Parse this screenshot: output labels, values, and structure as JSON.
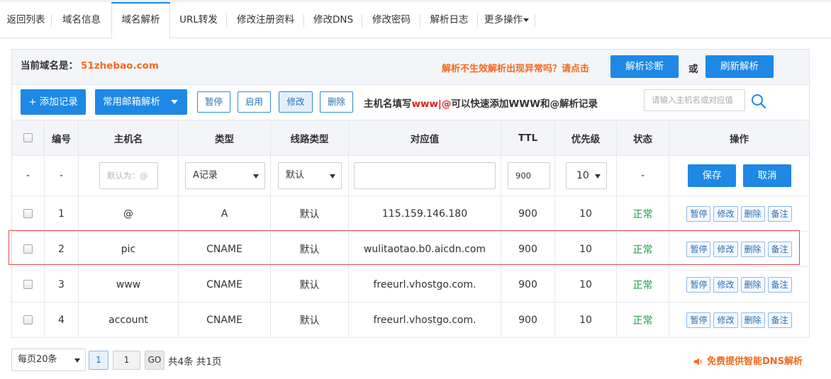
{
  "tabs": [
    {
      "label": "返回列表"
    },
    {
      "label": "域名信息"
    },
    {
      "label": "域名解析"
    },
    {
      "label": "URL转发"
    },
    {
      "label": "修改注册资料"
    },
    {
      "label": "修改DNS"
    },
    {
      "label": "修改密码"
    },
    {
      "label": "解析日志"
    },
    {
      "label": "更多操作"
    }
  ],
  "info": {
    "current_label": "当前域名是：",
    "domain": "51zhebao.com",
    "diag_note": "解析不生效解析出现异常吗？请点击",
    "diag_button": "解析诊断",
    "or_text": "或",
    "refresh_button": "刷新解析"
  },
  "toolbar": {
    "add_record": "+ 添加记录",
    "mail_resolve": "常用邮箱解析",
    "pause": "暂停",
    "enable": "启用",
    "modify": "修改",
    "delete": "删除",
    "hint_prefix": "主机名填写",
    "hint_red": "www|@",
    "hint_suffix": "可以快速添加WWW和@解析记录",
    "search_placeholder": "请输入主机名或对应值"
  },
  "table": {
    "headers": [
      "编号",
      "主机名",
      "类型",
      "线路类型",
      "对应值",
      "TTL",
      "优先级",
      "状态",
      "操作"
    ],
    "new_row": {
      "index": "-",
      "number": "-",
      "host_placeholder": "默认为：@",
      "type": "A记录",
      "line": "默认",
      "value": "",
      "ttl": "900",
      "priority": "10",
      "status": "-",
      "save": "保存",
      "cancel": "取消"
    },
    "rows": [
      {
        "num": "1",
        "host": "@",
        "type": "A",
        "line": "默认",
        "value": "115.159.146.180",
        "ttl": "900",
        "priority": "10",
        "status": "正常"
      },
      {
        "num": "2",
        "host": "pic",
        "type": "CNAME",
        "line": "默认",
        "value": "wulitaotao.b0.aicdn.com",
        "ttl": "900",
        "priority": "10",
        "status": "正常"
      },
      {
        "num": "3",
        "host": "www",
        "type": "CNAME",
        "line": "默认",
        "value": "freeurl.vhostgo.com.",
        "ttl": "900",
        "priority": "10",
        "status": "正常"
      },
      {
        "num": "4",
        "host": "account",
        "type": "CNAME",
        "line": "默认",
        "value": "freeurl.vhostgo.com.",
        "ttl": "900",
        "priority": "10",
        "status": "正常"
      }
    ],
    "row_actions": {
      "pause": "暂停",
      "modify": "修改",
      "delete": "删除",
      "note": "备注"
    }
  },
  "pagination": {
    "per_page": "每页20条",
    "current_page": "1",
    "goto_value": "1",
    "go": "GO",
    "total": "共4条 共1页"
  },
  "promo": "免费提供智能DNS解析",
  "colors": {
    "accent": "#1e88e5",
    "orange": "#f36a21",
    "status_ok": "#1a9c4a",
    "highlight": "#e24b4b"
  }
}
